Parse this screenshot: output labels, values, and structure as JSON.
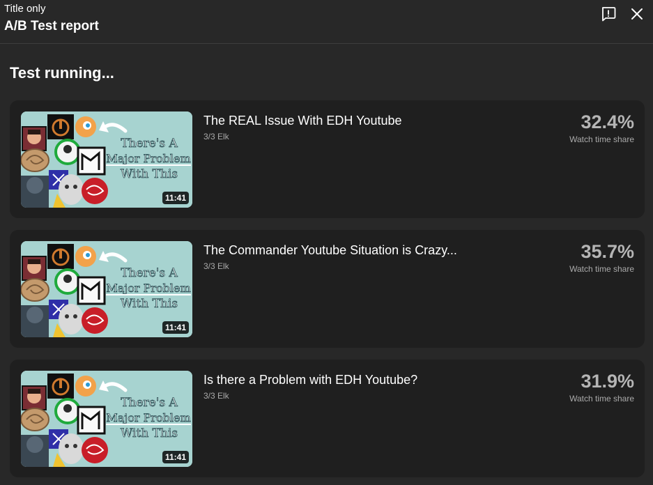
{
  "header": {
    "subtitle": "Title only",
    "title": "A/B Test report",
    "feedback_icon": "feedback-icon",
    "close_icon": "close-icon"
  },
  "status": "Test running...",
  "colors": {
    "background": "#282828",
    "card": "#1f1f1f",
    "percent": "#b5b5b5",
    "secondary_text": "#aaaaaa",
    "thumbnail_bg": "#a7d3d0"
  },
  "thumbnail_text": [
    "There's A",
    "Major Problem",
    "With This"
  ],
  "variants": [
    {
      "title": "The REAL Issue With EDH Youtube",
      "channel": "3/3 Elk",
      "duration": "11:41",
      "share": "32.4%",
      "share_label": "Watch time share"
    },
    {
      "title": "The Commander Youtube Situation is Crazy...",
      "channel": "3/3 Elk",
      "duration": "11:41",
      "share": "35.7%",
      "share_label": "Watch time share"
    },
    {
      "title": "Is there a Problem with EDH Youtube?",
      "channel": "3/3 Elk",
      "duration": "11:41",
      "share": "31.9%",
      "share_label": "Watch time share"
    }
  ]
}
